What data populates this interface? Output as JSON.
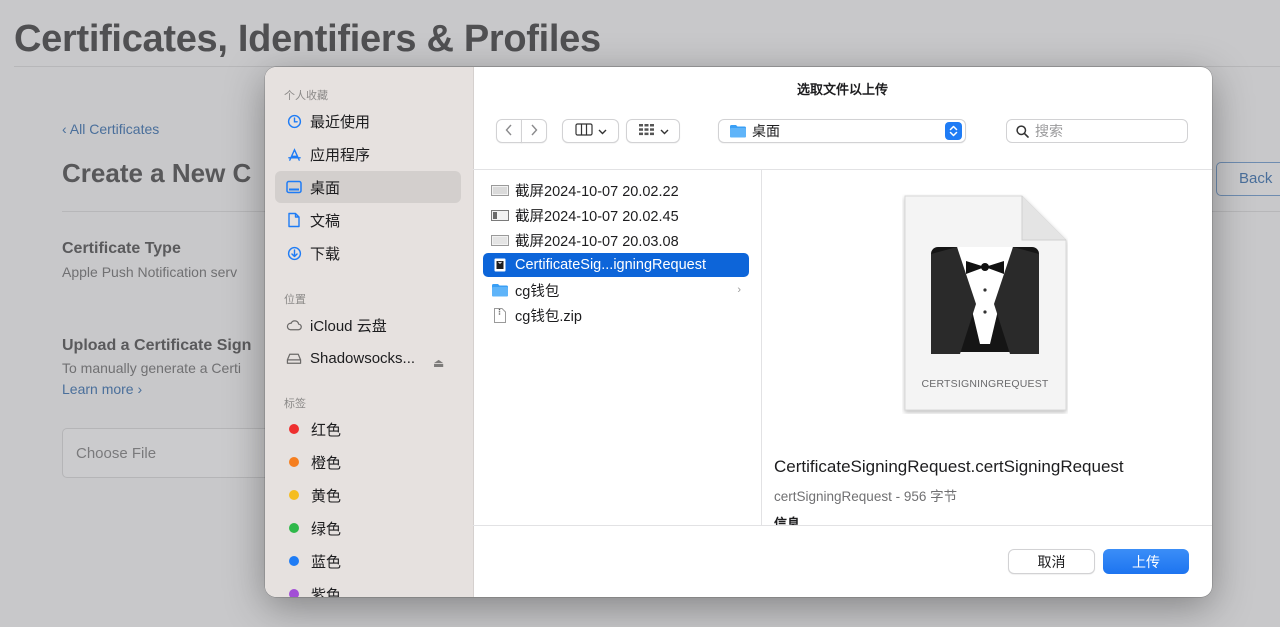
{
  "page": {
    "title": "Certificates, Identifiers & Profiles",
    "back_link": "‹ All Certificates",
    "create_heading": "Create a New C",
    "back_button": "Back",
    "certificate_type_label": "Certificate Type",
    "certificate_type_value": "Apple Push Notification serv",
    "upload_label": "Upload a Certificate Sign",
    "upload_help": "To manually generate a Certi",
    "learn_more": "Learn more ›",
    "choose_file": "Choose File"
  },
  "dialog": {
    "title": "选取文件以上传",
    "sidebar": {
      "favorites_header": "个人收藏",
      "favorites": [
        {
          "label": "最近使用",
          "icon": "clock-icon"
        },
        {
          "label": "应用程序",
          "icon": "applications-icon"
        },
        {
          "label": "桌面",
          "icon": "desktop-icon",
          "selected": true
        },
        {
          "label": "文稿",
          "icon": "document-icon"
        },
        {
          "label": "下载",
          "icon": "download-icon"
        }
      ],
      "locations_header": "位置",
      "locations": [
        {
          "label": "iCloud 云盘",
          "icon": "cloud-icon"
        },
        {
          "label": "Shadowsocks...",
          "icon": "drive-icon"
        }
      ],
      "tags_header": "标签",
      "tags": [
        {
          "label": "红色",
          "color": "#ee2f2f"
        },
        {
          "label": "橙色",
          "color": "#f57e1f"
        },
        {
          "label": "黄色",
          "color": "#f5bd1f"
        },
        {
          "label": "绿色",
          "color": "#2fb84a"
        },
        {
          "label": "蓝色",
          "color": "#1f7cf5"
        },
        {
          "label": "紫色",
          "color": "#a24fd6"
        }
      ]
    },
    "toolbar": {
      "location": "桌面",
      "search_placeholder": "搜索"
    },
    "files": [
      {
        "name": "截屏2024-10-07 20.02.22",
        "icon": "screenshot-icon"
      },
      {
        "name": "截屏2024-10-07 20.02.45",
        "icon": "screenshot-icon"
      },
      {
        "name": "截屏2024-10-07 20.03.08",
        "icon": "screenshot-icon"
      },
      {
        "name": "CertificateSig...igningRequest",
        "icon": "certificate-file-icon",
        "selected": true
      },
      {
        "name": "cg钱包",
        "icon": "folder-icon",
        "has_children": true
      },
      {
        "name": "cg钱包.zip",
        "icon": "zip-icon"
      }
    ],
    "preview": {
      "doc_type": "CERTSIGNINGREQUEST",
      "name": "CertificateSigningRequest.certSigningRequest",
      "meta": "certSigningRequest - 956 字节",
      "info_header": "信息"
    },
    "buttons": {
      "cancel": "取消",
      "upload": "上传"
    }
  }
}
